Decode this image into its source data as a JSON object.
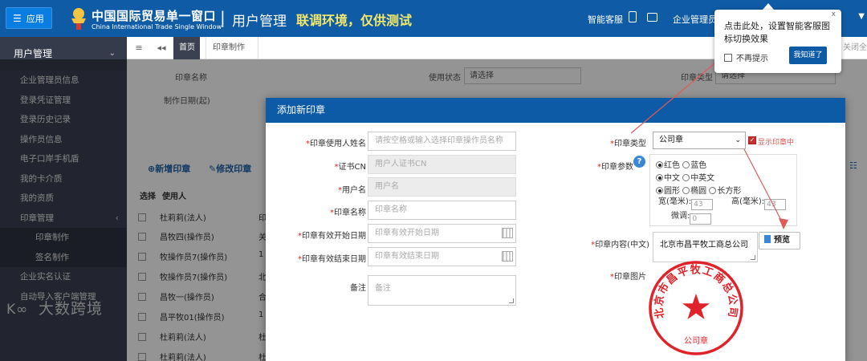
{
  "header": {
    "app_button": "应用",
    "brand_cn": "中国国际贸易单一窗口",
    "brand_en": "China International Trade Single Window",
    "separator": "|",
    "page_title": "用户管理",
    "env_title": "联调环境，仅供测试",
    "smart_service": "智能客服",
    "company_admin": "企业管理员"
  },
  "sidebar": {
    "section": "用户管理",
    "items": [
      {
        "label": "企业管理员信息"
      },
      {
        "label": "登录凭证管理"
      },
      {
        "label": "登录历史记录"
      },
      {
        "label": "操作员信息"
      },
      {
        "label": "电子口岸手机盾"
      },
      {
        "label": "我的卡介质"
      },
      {
        "label": "我的资质"
      },
      {
        "label": "印章管理"
      },
      {
        "label": "印章制作"
      },
      {
        "label": "签名制作"
      },
      {
        "label": "企业实名认证"
      },
      {
        "label": "自动导入客户端管理"
      }
    ],
    "watermark": "大数跨境"
  },
  "tabs": {
    "home": "首页",
    "active": "印章制作",
    "close_all": "关闭全"
  },
  "background": {
    "seal_name_label": "印章名称",
    "status_label": "使用状态",
    "status_value": "请选择",
    "type_label": "印章类型",
    "type_value": "请选择",
    "date_label": "制作日期(起)",
    "new_seal": "新增印章",
    "edit_seal": "修改印章",
    "col_select": "选择",
    "col_user": "使用人",
    "rows": [
      {
        "name": "杜莉莉(法人)",
        "extra": "印"
      },
      {
        "name": "昌牧四(操作员)",
        "extra": "关"
      },
      {
        "name": "牧操作员7(操作员)",
        "extra": "1"
      },
      {
        "name": "牧操作员7(操作员)",
        "extra": "北"
      },
      {
        "name": "昌牧一(操作员)",
        "extra": "合"
      },
      {
        "name": "昌平牧01(操作员)",
        "extra": "1"
      },
      {
        "name": "杜莉莉(法人)",
        "extra": "杜"
      },
      {
        "name": "杜莉莉(法人)",
        "extra": "杜"
      }
    ]
  },
  "modal": {
    "title": "添加新印章",
    "user_name_label": "印章使用人姓名",
    "user_name_placeholder": "请按空格或输入选择印章操作员名称",
    "cert_label": "证书CN",
    "cert_placeholder": "用户人证书CN",
    "username_label": "用户名",
    "username_placeholder": "用户名",
    "seal_name_label": "印章名称",
    "seal_name_placeholder": "印章名称",
    "start_date_label": "印章有效开始日期",
    "start_date_placeholder": "印章有效开始日期",
    "end_date_label": "印章有效结束日期",
    "end_date_placeholder": "印章有效结束日期",
    "remark_label": "备注",
    "remark_placeholder": "备注",
    "type_label": "印章类型",
    "type_value": "公司章",
    "show_in_seal": "显示印章中",
    "params_label": "印章参数",
    "help": "?",
    "color_red": "红色",
    "color_blue": "蓝色",
    "lang_cn": "中文",
    "lang_cn_en": "中英文",
    "shape_round": "圆形",
    "shape_oval": "椭圆",
    "shape_rect": "长方形",
    "width_label": "宽(毫米):",
    "width_value": "43",
    "height_label": "高(毫米):",
    "height_value": "43",
    "fine_label": "微调:",
    "fine_value": "0",
    "content_label": "印章内容(中文)",
    "content_value": "北京市昌平牧工商总公司",
    "preview": "预览",
    "image_label": "印章图片",
    "stamp_text": "北京市昌平牧工商总公司",
    "stamp_type": "公司章",
    "stamp_color": "#e0232b"
  },
  "tooltip": {
    "text": "点击此处，设置智能客服图标切换效果",
    "close": "x",
    "dont_remind": "不再提示",
    "got_it": "我知道了"
  },
  "colors": {
    "header": "#0f5ba6",
    "sidebar": "#3c4152",
    "env_text": "#f4e86a",
    "accent": "#0d5aa7"
  }
}
